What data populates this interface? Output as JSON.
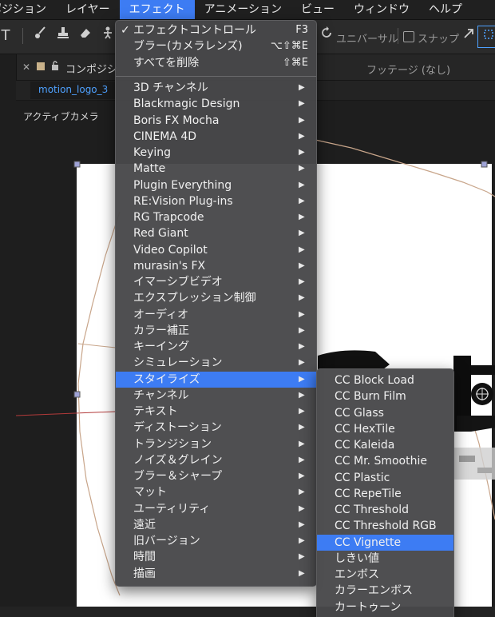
{
  "menubar": {
    "items": [
      {
        "label": "ポジション",
        "active": false
      },
      {
        "label": "レイヤー",
        "active": false
      },
      {
        "label": "エフェクト",
        "active": true
      },
      {
        "label": "アニメーション",
        "active": false
      },
      {
        "label": "ビュー",
        "active": false
      },
      {
        "label": "ウィンドウ",
        "active": false
      },
      {
        "label": "ヘルプ",
        "active": false
      }
    ]
  },
  "toolbar": {
    "universal_label": "ユニバーサル",
    "snap_label": "スナップ"
  },
  "panel": {
    "tab_title": "コンポジシ",
    "footage_label": "フッテージ (なし)",
    "comp_tab": "motion_logo_3",
    "camera_label": "アクティブカメラ"
  },
  "effects_menu": {
    "top_items": [
      {
        "label": "エフェクトコントロール",
        "shortcut": "F3",
        "checked": true
      },
      {
        "label": "ブラー(カメラレンズ)",
        "shortcut": "⌥⇧⌘E",
        "checked": false
      },
      {
        "label": "すべてを削除",
        "shortcut": "⇧⌘E",
        "checked": false
      }
    ],
    "categories": [
      "3D チャンネル",
      "Blackmagic Design",
      "Boris FX Mocha",
      "CINEMA 4D",
      "Keying",
      "Matte",
      "Plugin Everything",
      "RE:Vision Plug-ins",
      "RG Trapcode",
      "Red Giant",
      "Video Copilot",
      "murasin's FX",
      "イマーシブビデオ",
      "エクスプレッション制御",
      "オーディオ",
      "カラー補正",
      "キーイング",
      "シミュレーション",
      "スタイライズ",
      "チャンネル",
      "テキスト",
      "ディストーション",
      "トランジション",
      "ノイズ＆グレイン",
      "ブラー＆シャープ",
      "マット",
      "ユーティリティ",
      "遠近",
      "旧バージョン",
      "時間",
      "描画"
    ],
    "highlighted": "スタイライズ"
  },
  "stylize_menu": {
    "items": [
      "CC Block Load",
      "CC Burn Film",
      "CC Glass",
      "CC HexTile",
      "CC Kaleida",
      "CC Mr. Smoothie",
      "CC Plastic",
      "CC RepeTile",
      "CC Threshold",
      "CC Threshold RGB",
      "CC Vignette",
      "しきい値",
      "エンボス",
      "カラーエンボス",
      "カートゥーン"
    ],
    "highlighted": "CC Vignette"
  },
  "colors": {
    "accent": "#3d7cf3",
    "menu_bg": "#48484a",
    "comp_tab_text": "#4ea1ff"
  }
}
